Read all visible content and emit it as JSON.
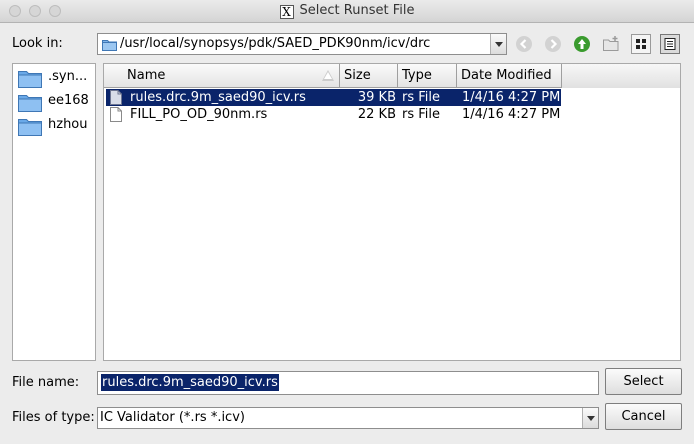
{
  "window": {
    "title": "Select Runset File"
  },
  "look_in": {
    "label": "Look in:",
    "path": "/usr/local/synopsys/pdk/SAED_PDK90nm/icv/drc"
  },
  "toolbar": {
    "icons": [
      "back-icon",
      "forward-icon",
      "parent-directory-icon",
      "new-folder-icon",
      "list-view-icon",
      "detail-view-icon"
    ]
  },
  "places": [
    {
      "label": ".syn..."
    },
    {
      "label": "ee168"
    },
    {
      "label": "hzhou"
    }
  ],
  "table": {
    "headers": {
      "name": "Name",
      "size": "Size",
      "type": "Type",
      "date": "Date Modified"
    },
    "rows": [
      {
        "name": "rules.drc.9m_saed90_icv.rs",
        "size": "39 KB",
        "type": "rs File",
        "date": "1/4/16 4:27 PM",
        "selected": true
      },
      {
        "name": "FILL_PO_OD_90nm.rs",
        "size": "22 KB",
        "type": "rs File",
        "date": "1/4/16 4:27 PM",
        "selected": false
      }
    ]
  },
  "file_name": {
    "label": "File name:",
    "value": "rules.drc.9m_saed90_icv.rs"
  },
  "files_of_type": {
    "label": "Files of type:",
    "value": "IC Validator (*.rs *.icv)"
  },
  "buttons": {
    "select": "Select",
    "cancel": "Cancel"
  },
  "colors": {
    "selection": "#0a246a",
    "folder": "#4a90d9",
    "up_arrow": "#3a9b2e"
  }
}
